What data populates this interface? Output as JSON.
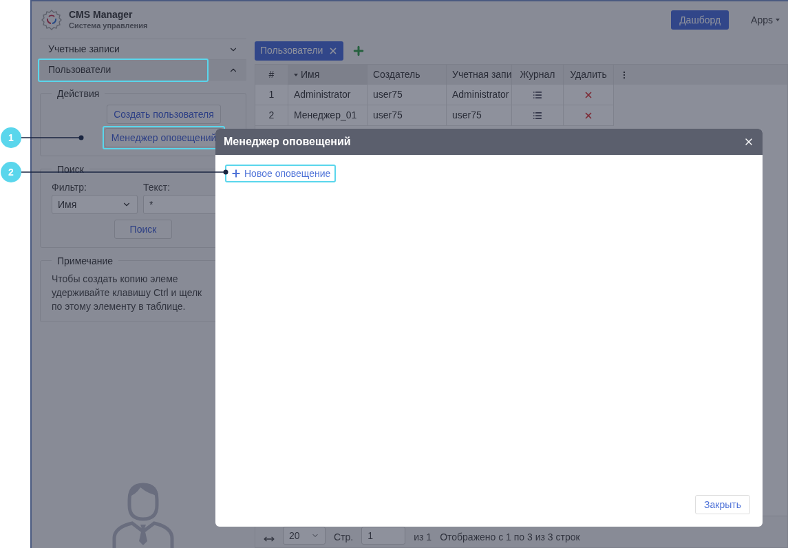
{
  "app": {
    "title": "CMS Manager",
    "subtitle": "Система управления",
    "dashboard_button": "Дашборд",
    "apps_menu": "Apps"
  },
  "sidebar": {
    "sections": [
      {
        "label": "Учетные записи",
        "expanded": false,
        "highlighted": false
      },
      {
        "label": "Пользователи",
        "expanded": true,
        "highlighted": true
      }
    ],
    "actions": {
      "legend": "Действия",
      "buttons": [
        {
          "label": "Создать пользователя",
          "highlighted": false
        },
        {
          "label": "Менеджер оповещений",
          "highlighted": true
        }
      ]
    },
    "search": {
      "legend": "Поиск",
      "filter_label": "Фильтр:",
      "filter_value": "Имя",
      "text_label": "Текст:",
      "text_value": "*",
      "button": "Поиск"
    },
    "note": {
      "legend": "Примечание",
      "lines": [
        "Чтобы создать копию элеме",
        "удерживайте клавишу Ctrl и щелк",
        "по этому элементу в таблице."
      ]
    }
  },
  "tabs": [
    {
      "label": "Пользователи",
      "selected": true
    }
  ],
  "table": {
    "columns": [
      {
        "label": "#",
        "sorted": false
      },
      {
        "label": "Имя",
        "sorted": true
      },
      {
        "label": "Создатель",
        "sorted": false
      },
      {
        "label": "Учетная запи",
        "sorted": false
      },
      {
        "label": "Журнал",
        "sorted": false
      },
      {
        "label": "Удалить",
        "sorted": false
      }
    ],
    "rows": [
      [
        "1",
        "Administrator",
        "user75",
        "Administrator"
      ],
      [
        "2",
        "Менеджер_01",
        "user75",
        "user75"
      ]
    ]
  },
  "pager": {
    "page_size": "20",
    "page_label": "Стр.",
    "page": "1",
    "of": "из 1",
    "summary": "Отображено с 1 по 3 из 3 строк"
  },
  "dialog": {
    "title": "Менеджер оповещений",
    "new_button": "Новое оповещение",
    "new_highlighted": true,
    "close_button": "Закрыть"
  },
  "callouts": [
    {
      "number": "1"
    },
    {
      "number": "2"
    }
  ]
}
